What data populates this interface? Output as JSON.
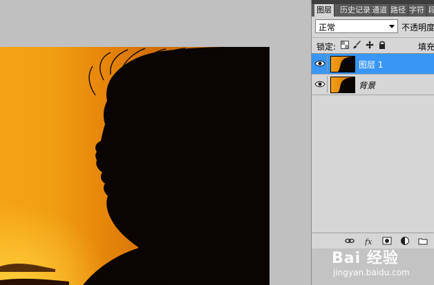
{
  "panel": {
    "tabs": [
      "图层",
      "历史记录",
      "通道",
      "路径",
      "字符",
      "段"
    ],
    "blend_mode": "正常",
    "opacity_label": "不透明度",
    "lock_label": "锁定:",
    "fill_label": "填充",
    "layers": [
      {
        "name": "图层 1",
        "selected": true,
        "visible": true
      },
      {
        "name": "背景",
        "selected": false,
        "visible": true
      }
    ]
  },
  "icons": {
    "visibility": "eye-icon",
    "lock_transparent": "checkerboard-icon",
    "lock_pixels": "brush-icon",
    "lock_position": "move-icon",
    "lock_all": "padlock-icon",
    "link": "link-icon",
    "effects": "fx-icon",
    "mask": "mask-icon",
    "adjustment": "adjustment-icon",
    "new_group": "folder-icon"
  },
  "colors": {
    "selection": "#3a96f5",
    "panel_bg": "#d6d6d6",
    "workspace_bg": "#c0c0c0"
  },
  "watermark": {
    "brand": "Bai 经验",
    "url": "jingyan.baidu.com"
  }
}
